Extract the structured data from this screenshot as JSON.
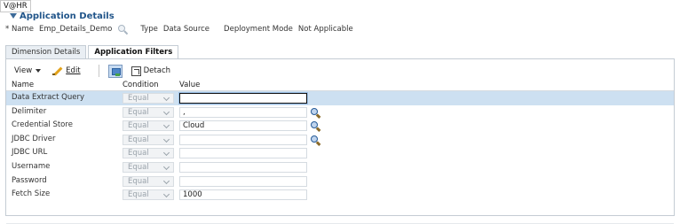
{
  "user": "V@HR",
  "section": {
    "title": "Application Details"
  },
  "details": {
    "name_label": "* Name",
    "name_value": "Emp_Details_Demo",
    "type_label": "Type",
    "type_value": "Data Source",
    "mode_label": "Deployment Mode",
    "mode_value": "Not Applicable"
  },
  "tabs": [
    {
      "label": "Dimension Details",
      "active": false
    },
    {
      "label": "Application Filters",
      "active": true
    }
  ],
  "toolbar": {
    "view_label": "View",
    "edit_label": "Edit",
    "detach_label": "Detach"
  },
  "columns": {
    "name": "Name",
    "condition": "Condition",
    "value": "Value"
  },
  "rows": [
    {
      "name": "Data Extract Query",
      "condition": "Equal",
      "value": "",
      "lookup": false
    },
    {
      "name": "Delimiter",
      "condition": "Equal",
      "value": ",",
      "lookup": true
    },
    {
      "name": "Credential Store",
      "condition": "Equal",
      "value": "Cloud",
      "lookup": true
    },
    {
      "name": "JDBC Driver",
      "condition": "Equal",
      "value": "",
      "lookup": true
    },
    {
      "name": "JDBC URL",
      "condition": "Equal",
      "value": "",
      "lookup": false
    },
    {
      "name": "Username",
      "condition": "Equal",
      "value": "",
      "lookup": false
    },
    {
      "name": "Password",
      "condition": "Equal",
      "value": "",
      "lookup": false
    },
    {
      "name": "Fetch Size",
      "condition": "Equal",
      "value": "1000",
      "lookup": false
    }
  ],
  "selected_row": 0,
  "colors": {
    "title": "#21558a",
    "selected_row": "#cde0f1"
  }
}
